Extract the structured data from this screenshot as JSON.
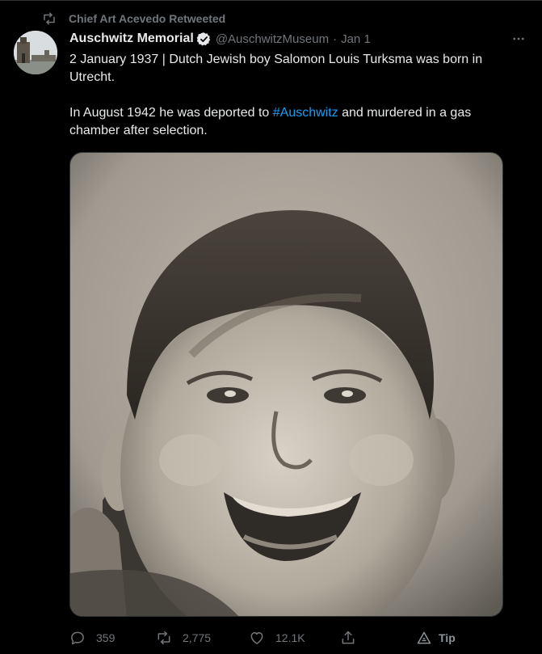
{
  "retweet": {
    "text": "Chief Art Acevedo Retweeted",
    "icon": "retweet-icon"
  },
  "author": {
    "name": "Auschwitz Memorial",
    "handle": "@AuschwitzMuseum",
    "separator": "·",
    "date": "Jan 1",
    "verified": true
  },
  "tweet": {
    "paragraph1": "2 January 1937 | Dutch Jewish boy Salomon Louis Turksma was born in Utrecht.",
    "paragraph2_before": "In August 1942 he was deported to ",
    "hashtag": "#Auschwitz",
    "paragraph2_after": " and murdered in a gas chamber after selection."
  },
  "actions": {
    "replies": "359",
    "retweets": "2,775",
    "likes": "12.1K",
    "tip": "Tip"
  },
  "colors": {
    "background": "#000000",
    "text": "#e7e9ea",
    "muted": "#71767b",
    "link": "#1d9bf0",
    "verified_badge": "#1d9bf0"
  }
}
